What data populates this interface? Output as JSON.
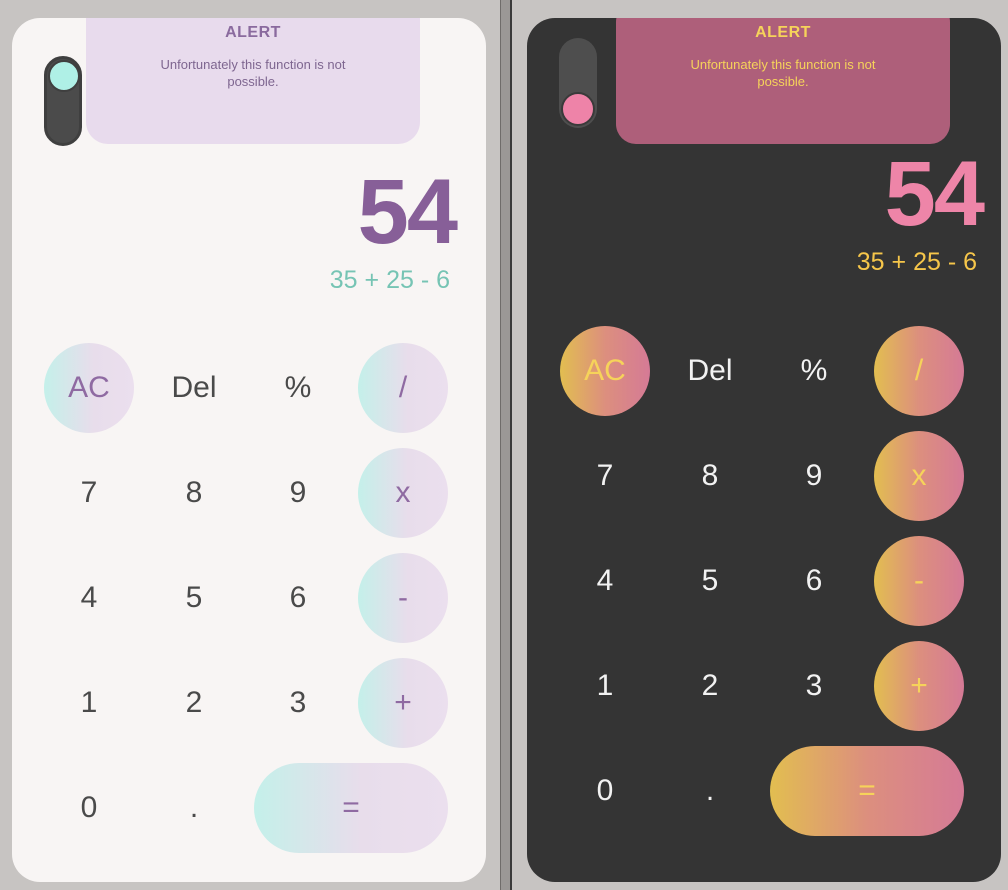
{
  "alert": {
    "title": "ALERT",
    "message": "Unfortunately this function is not possible."
  },
  "display": {
    "result": "54",
    "expression": "35 + 25 - 6"
  },
  "keys": {
    "ac": "AC",
    "del": "Del",
    "percent": "%",
    "divide": "/",
    "k7": "7",
    "k8": "8",
    "k9": "9",
    "multiply": "x",
    "k4": "4",
    "k5": "5",
    "k6": "6",
    "minus": "-",
    "k1": "1",
    "k2": "2",
    "k3": "3",
    "plus": "+",
    "k0": "0",
    "dot": ".",
    "equals": "="
  },
  "themes": {
    "light": {
      "background": "#f8f5f4",
      "accent": "#875f98",
      "secondary": "#76c4b4",
      "toggle": "off"
    },
    "dark": {
      "background": "#343434",
      "accent": "#ee85a8",
      "secondary": "#f6c64a",
      "toggle": "on"
    }
  }
}
